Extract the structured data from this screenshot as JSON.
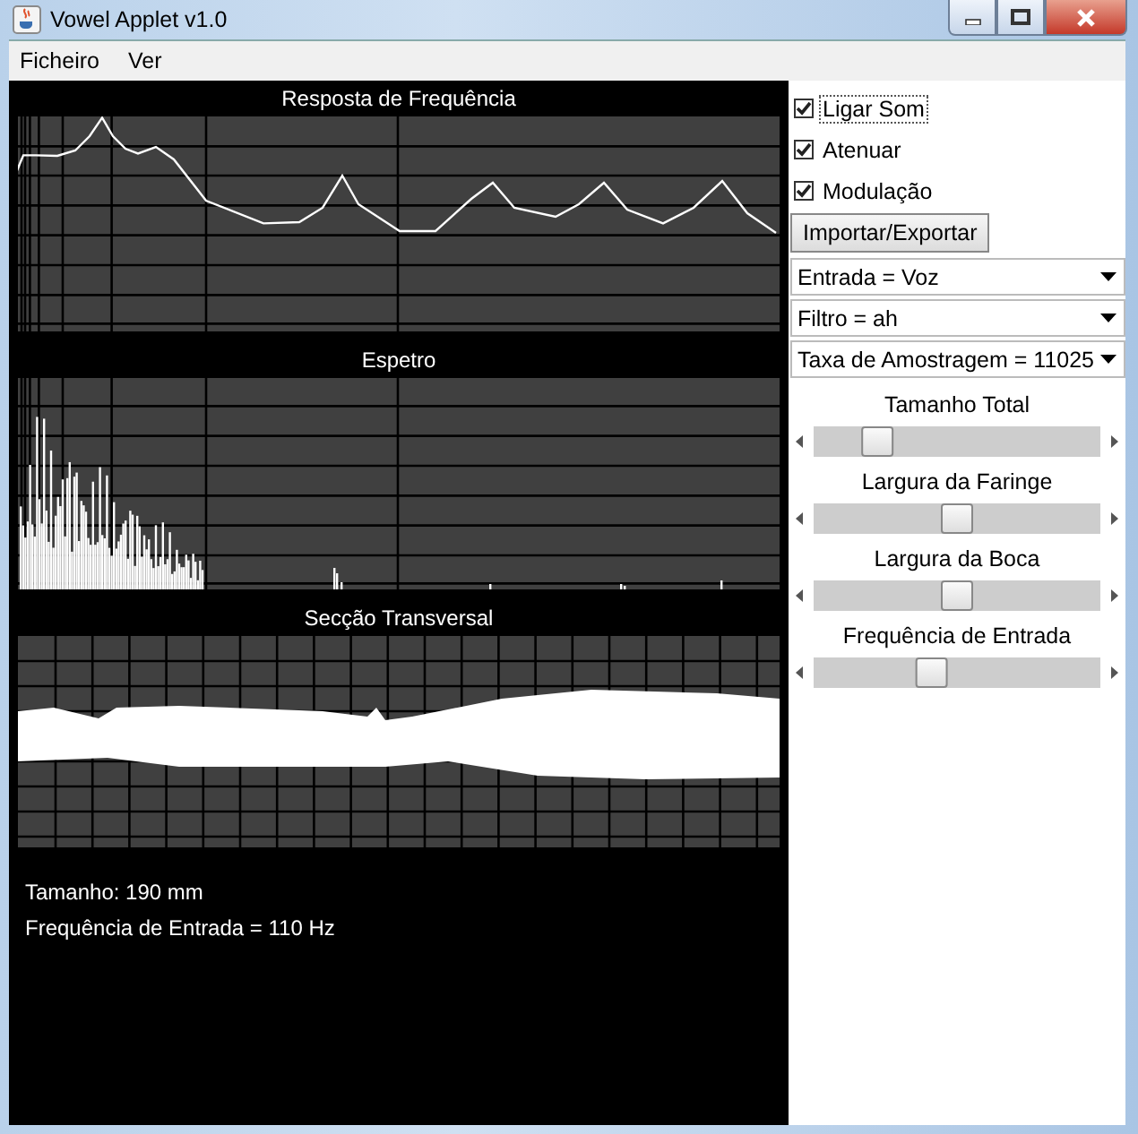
{
  "window": {
    "title": "Vowel Applet v1.0"
  },
  "menu": [
    "Ficheiro",
    "Ver"
  ],
  "graphs": [
    {
      "title": "Resposta de Frequência",
      "kind": "response"
    },
    {
      "title": "Espetro",
      "kind": "spectrum"
    },
    {
      "title": "Secção Transversal",
      "kind": "section"
    }
  ],
  "readouts": [
    "Tamanho: 190 mm",
    "Frequência de Entrada = 110 Hz"
  ],
  "checkboxes": [
    {
      "label": "Ligar Som",
      "checked": true,
      "focused": true
    },
    {
      "label": "Atenuar",
      "checked": true,
      "focused": false
    },
    {
      "label": "Modulação",
      "checked": true,
      "focused": false
    }
  ],
  "button": "Importar/Exportar",
  "dropdowns": [
    "Entrada = Voz",
    "Filtro = ah",
    "Taxa de Amostragem = 11025"
  ],
  "sliders": [
    {
      "label": "Tamanho Total",
      "level": 0.19
    },
    {
      "label": "Largura da Faringe",
      "level": 0.5
    },
    {
      "label": "Largura da Boca",
      "level": 0.5
    },
    {
      "label": "Frequência de Entrada",
      "level": 0.4
    }
  ]
}
